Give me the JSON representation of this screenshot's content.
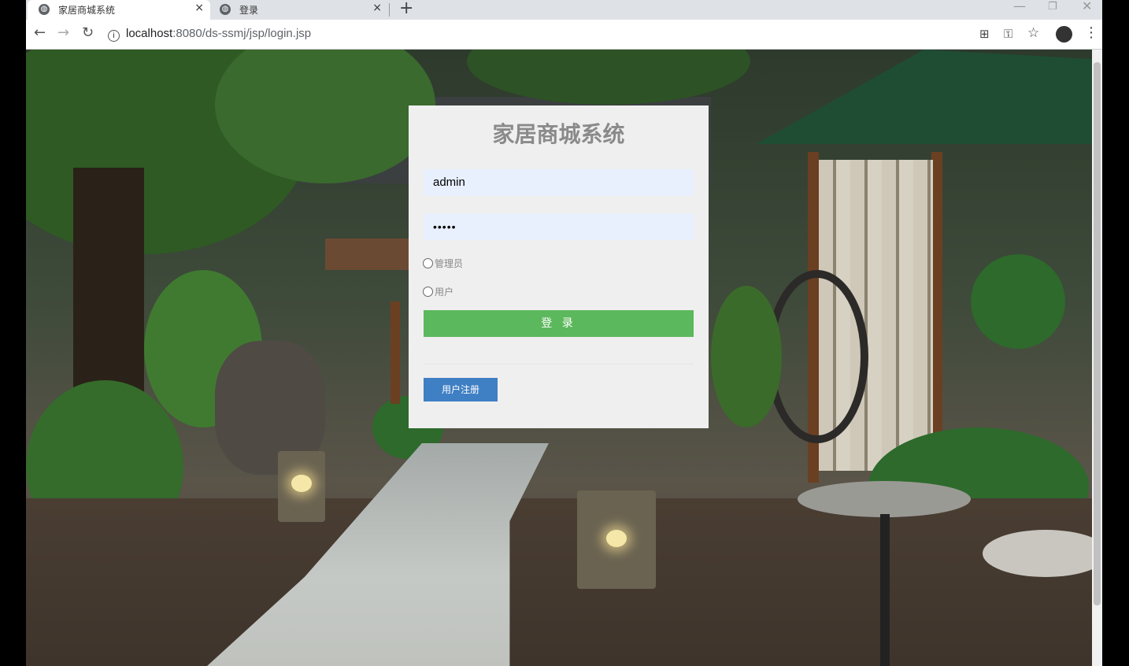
{
  "browser": {
    "tabs": [
      {
        "title": "家居商城系统",
        "close": "×",
        "icon": "globe-icon"
      },
      {
        "title": "登录",
        "close": "×",
        "icon": "globe-icon"
      }
    ],
    "new_tab": "+",
    "window_controls": {
      "minimize": "—",
      "restore": "❐",
      "close": "✕"
    },
    "nav": {
      "back": "←",
      "forward": "→",
      "reload": "↻"
    },
    "address": {
      "info": "i",
      "host": "localhost",
      "path": ":8080/ds-ssmj/jsp/login.jsp"
    },
    "toolbar_icons": {
      "qr": "⊞",
      "key": "⚿",
      "star": "☆",
      "menu": "⋮"
    }
  },
  "login": {
    "title": "家居商城系统",
    "username": "admin",
    "password": "•••••",
    "roles": [
      "管理员",
      "用户"
    ],
    "login_button": "登 录",
    "register_button": "用户注册"
  }
}
